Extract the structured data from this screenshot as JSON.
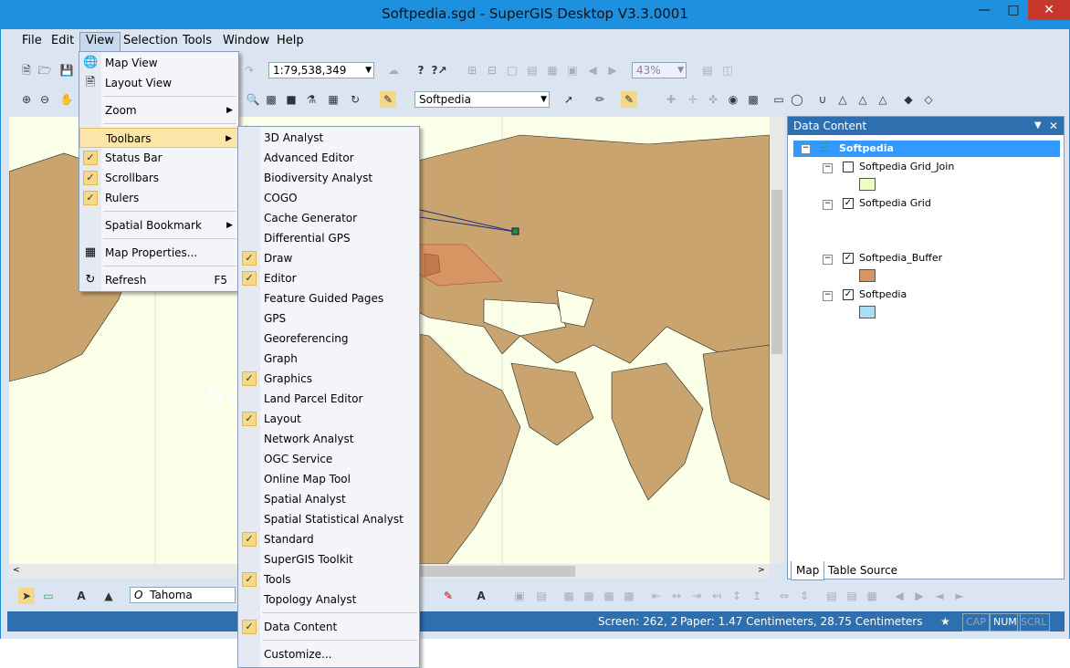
{
  "window": {
    "title": "Softpedia.sgd - SuperGIS Desktop V3.3.0001",
    "minimize": "—",
    "maximize": "□",
    "close": "✕"
  },
  "menubar": [
    {
      "label": "File"
    },
    {
      "label": "Edit"
    },
    {
      "label": "View"
    },
    {
      "label": "Selection"
    },
    {
      "label": "Tools"
    },
    {
      "label": "Window"
    },
    {
      "label": "Help"
    }
  ],
  "toolbar": {
    "scale": "1:79,538,349",
    "zoom": "43%",
    "layer_combo": "Softpedia"
  },
  "view_menu": [
    {
      "label": "Map View",
      "icon": "globe-icon"
    },
    {
      "label": "Layout View",
      "icon": "page-icon"
    },
    {
      "label": "Zoom",
      "submenu": true
    },
    {
      "label": "Toolbars",
      "submenu": true
    },
    {
      "label": "Status Bar",
      "checked": true
    },
    {
      "label": "Scrollbars",
      "checked": true
    },
    {
      "label": "Rulers",
      "checked": true
    },
    {
      "label": "Spatial Bookmark",
      "submenu": true
    },
    {
      "label": "Map Properties...",
      "icon": "properties-icon"
    },
    {
      "label": "Refresh",
      "icon": "refresh-icon",
      "shortcut": "F5"
    }
  ],
  "toolbars_menu": [
    {
      "label": "3D Analyst"
    },
    {
      "label": "Advanced Editor"
    },
    {
      "label": "Biodiversity Analyst"
    },
    {
      "label": "COGO"
    },
    {
      "label": "Cache Generator"
    },
    {
      "label": "Differential GPS"
    },
    {
      "label": "Draw",
      "checked": true
    },
    {
      "label": "Editor",
      "checked": true
    },
    {
      "label": "Feature Guided Pages"
    },
    {
      "label": "GPS"
    },
    {
      "label": "Georeferencing"
    },
    {
      "label": "Graph"
    },
    {
      "label": "Graphics",
      "checked": true
    },
    {
      "label": "Land Parcel Editor"
    },
    {
      "label": "Layout",
      "checked": true
    },
    {
      "label": "Network Analyst"
    },
    {
      "label": "OGC Service"
    },
    {
      "label": "Online Map Tool"
    },
    {
      "label": "Spatial Analyst"
    },
    {
      "label": "Spatial Statistical Analyst"
    },
    {
      "label": "Standard",
      "checked": true
    },
    {
      "label": "SuperGIS Toolkit"
    },
    {
      "label": "Tools",
      "checked": true
    },
    {
      "label": "Topology Analyst"
    },
    {
      "label": "Data Content",
      "checked": true
    },
    {
      "label": "Customize..."
    }
  ],
  "data_content": {
    "title": "Data Content",
    "root": "Softpedia",
    "layers": [
      {
        "name": "Softpedia Grid_Join",
        "checked": false,
        "color": "#eefcc4"
      },
      {
        "name": "Softpedia Grid",
        "checked": true,
        "color": ""
      },
      {
        "name": "Softpedia_Buffer",
        "checked": true,
        "color": "#d99463"
      },
      {
        "name": "Softpedia",
        "checked": true,
        "color": "#a8dff0"
      }
    ],
    "tabs": [
      "Map",
      "Table Source"
    ]
  },
  "draw_toolbar": {
    "font": "Tahoma"
  },
  "status": {
    "screen": "Screen: 262, 2",
    "paper": "Paper: 1.47 Centimeters, 28.75 Centimeters",
    "cap": "CAP",
    "num": "NUM",
    "scrl": "SCRL"
  },
  "watermark": "SOFTPEDIA",
  "colors": {
    "land": "#c9a46e",
    "water": "#fbffe8",
    "buffer": "#d99463",
    "titlebar": "#1e90e0",
    "menu_highlight": "#fbe6a8"
  }
}
